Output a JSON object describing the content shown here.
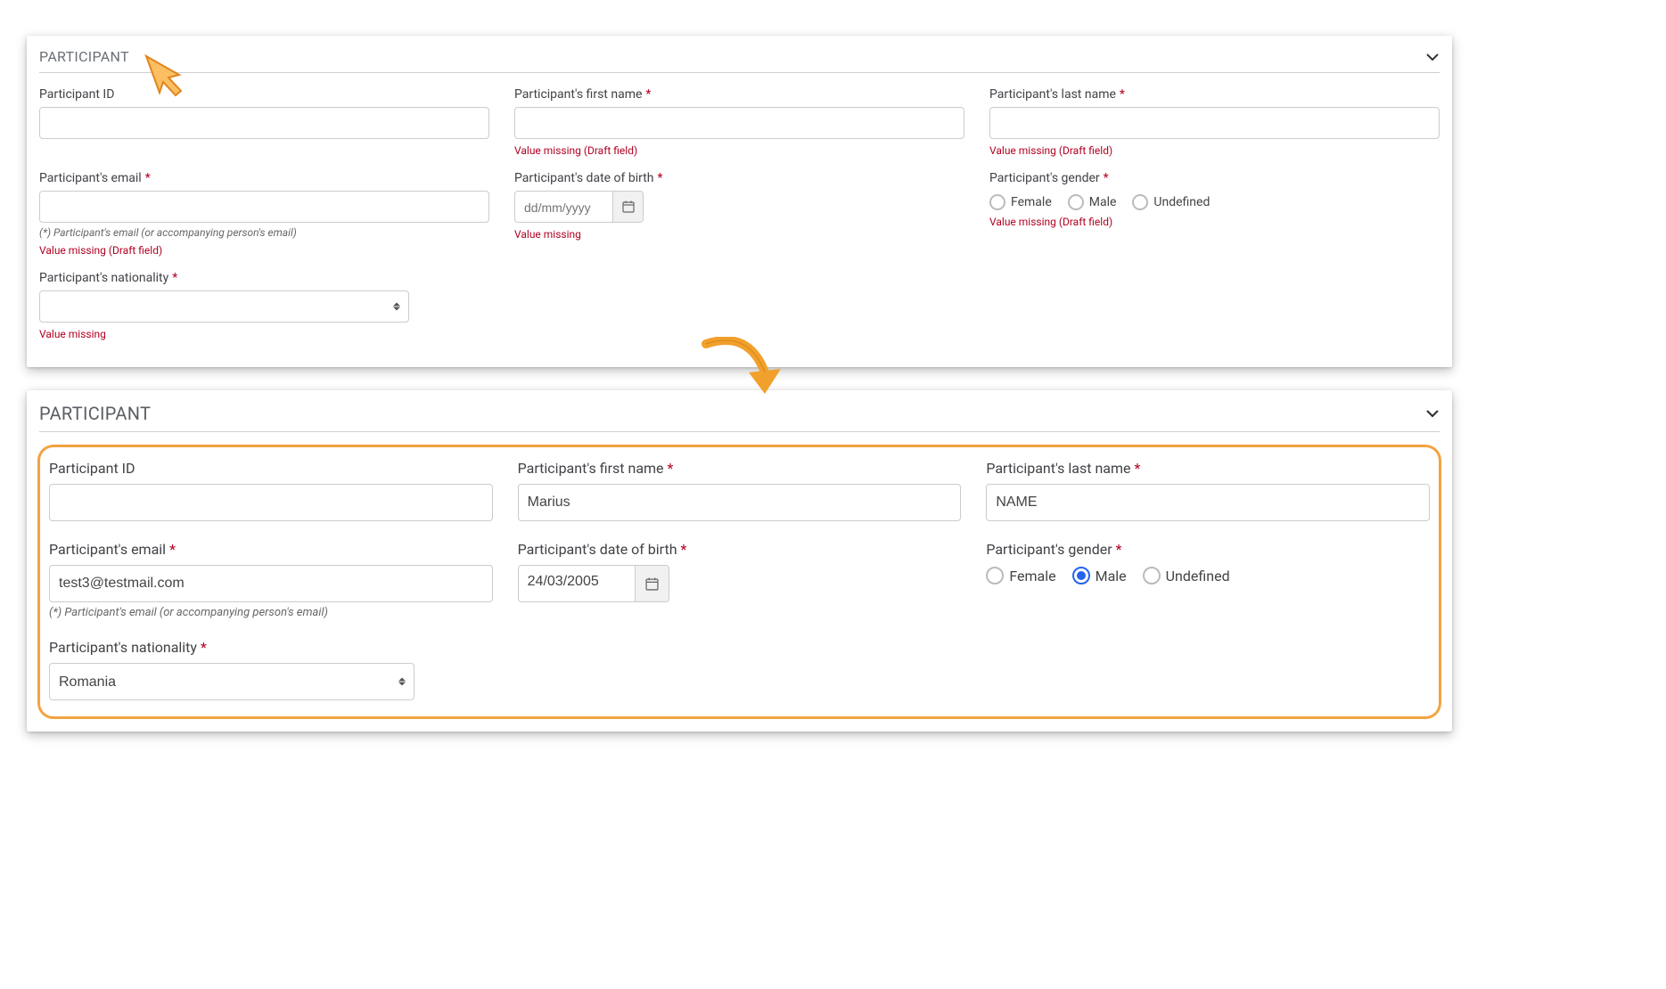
{
  "panel1": {
    "title": "PARTICIPANT",
    "fields": {
      "participant_id": {
        "label": "Participant ID"
      },
      "first_name": {
        "label": "Participant's first name",
        "required": true,
        "error": "Value missing (Draft field)"
      },
      "last_name": {
        "label": "Participant's last name",
        "required": true,
        "error": "Value missing (Draft field)"
      },
      "email": {
        "label": "Participant's email",
        "required": true,
        "hint": "(*) Participant's email (or accompanying person's email)",
        "error": "Value missing (Draft field)"
      },
      "dob": {
        "label": "Participant's date of birth",
        "required": true,
        "placeholder": "dd/mm/yyyy",
        "error": "Value missing"
      },
      "gender": {
        "label": "Participant's gender",
        "required": true,
        "options": [
          "Female",
          "Male",
          "Undefined"
        ],
        "error": "Value missing (Draft field)"
      },
      "nationality": {
        "label": "Participant's nationality",
        "required": true,
        "error": "Value missing"
      }
    }
  },
  "panel2": {
    "title": "PARTICIPANT",
    "fields": {
      "participant_id": {
        "label": "Participant ID",
        "value": ""
      },
      "first_name": {
        "label": "Participant's first name",
        "required": true,
        "value": "Marius"
      },
      "last_name": {
        "label": "Participant's last name",
        "required": true,
        "value": "NAME"
      },
      "email": {
        "label": "Participant's email",
        "required": true,
        "value": "test3@testmail.com",
        "hint": "(*) Participant's email (or accompanying person's email)"
      },
      "dob": {
        "label": "Participant's date of birth",
        "required": true,
        "value": "24/03/2005"
      },
      "gender": {
        "label": "Participant's gender",
        "required": true,
        "options": [
          "Female",
          "Male",
          "Undefined"
        ],
        "selected": "Male"
      },
      "nationality": {
        "label": "Participant's nationality",
        "required": true,
        "value": "Romania"
      }
    }
  },
  "colors": {
    "required": "#b00020",
    "highlight": "#f2a341",
    "arrow": "#f0a02b"
  }
}
